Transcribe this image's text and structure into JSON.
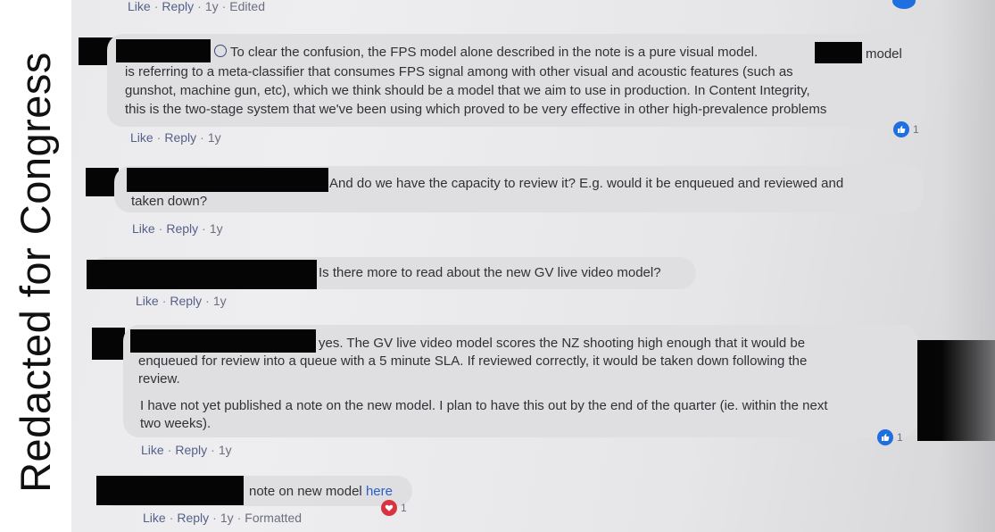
{
  "watermark": "Redacted for Congress",
  "top_meta": {
    "like": "Like",
    "reply": "Reply",
    "time": "1y",
    "edited": "Edited"
  },
  "comments": [
    {
      "line1_a": "To clear the confusion, the FPS model alone described in the note is a pure visual model.",
      "line1_b": "model",
      "line2": "is referring to a meta-classifier that consumes FPS signal among with other visual and acoustic features (such as",
      "line3": "gunshot, machine gun, etc), which we think should be a model that we aim to use in production. In Content Integrity,",
      "line4": "this is the two-stage system that we've been using which proved to be very effective in other high-prevalence problems",
      "like": "Like",
      "reply": "Reply",
      "time": "1y",
      "reaction_count": "1",
      "reaction_type": "like-icon"
    },
    {
      "line1": "And do we have the capacity to review it? E.g. would it be enqueued and reviewed and",
      "line2": "taken down?",
      "like": "Like",
      "reply": "Reply",
      "time": "1y"
    },
    {
      "line1": "Is there more to read about the new GV live video model?",
      "like": "Like",
      "reply": "Reply",
      "time": "1y"
    },
    {
      "line1": "yes. The GV live video model scores the NZ shooting high enough that it would be",
      "line2": "enqueued for review into a queue with a 5 minute SLA. If reviewed correctly, it would be taken down following the",
      "line3": "review.",
      "line4": "I have not yet published a note on the new model. I plan to have this out by the end of the quarter (ie. within the next",
      "line5": "two weeks).",
      "like": "Like",
      "reply": "Reply",
      "time": "1y",
      "reaction_count": "1",
      "reaction_type": "like-icon"
    },
    {
      "line1": "note on new model",
      "link": "here",
      "like": "Like",
      "reply": "Reply",
      "time": "1y",
      "formatted": "Formatted",
      "reaction_count": "1",
      "reaction_type": "love-icon"
    }
  ],
  "colors": {
    "like_reaction": "#1f6fe0",
    "love_reaction": "#d8333f",
    "bubble": "#dfdfe2",
    "link": "#2d5fc8"
  }
}
